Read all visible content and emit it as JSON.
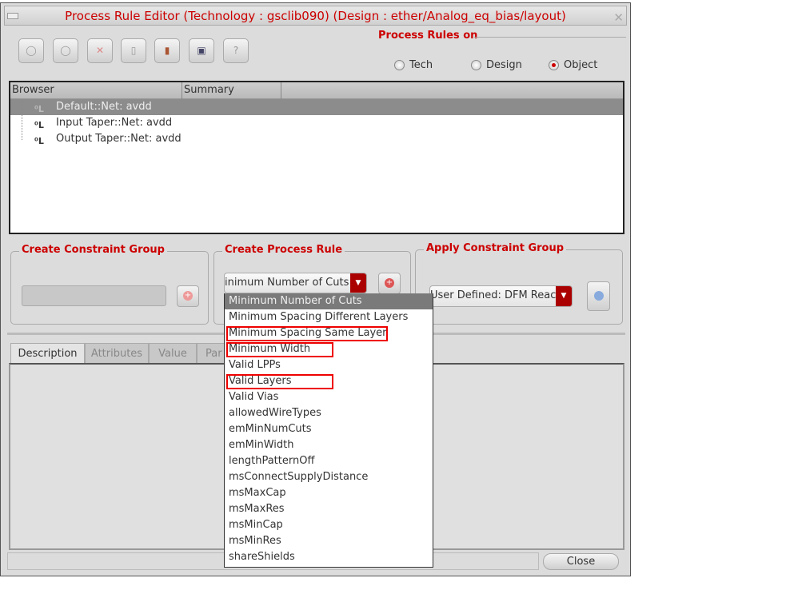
{
  "window": {
    "title": "Process Rule Editor (Technology : gsclib090) (Design : ether/Analog_eq_bias/layout)"
  },
  "toolbar": [
    "circle-icon",
    "circle-icon",
    "delete-icon",
    "copy-icon",
    "paste-icon",
    "save-icon",
    "?"
  ],
  "rules_on": {
    "label": "Process Rules on",
    "options": [
      "Tech",
      "Design",
      "Object"
    ],
    "selected": "Object"
  },
  "browser": {
    "columns": [
      "Browser",
      "Summary"
    ],
    "rows": [
      "Default::Net: avdd",
      "Input Taper::Net: avdd",
      "Output Taper::Net: avdd"
    ],
    "selected": 0
  },
  "groups": {
    "create_cg": "Create Constraint Group",
    "create_pr": "Create Process Rule",
    "apply_cg": "Apply Constraint Group"
  },
  "process_rule_value": "inimum Number of Cuts",
  "apply_value": "User Defined: DFM Reac",
  "tabs": [
    "Description",
    "Attributes",
    "Value",
    "Par"
  ],
  "dropdown": {
    "items": [
      "Minimum Number of Cuts",
      "Minimum Spacing Different Layers",
      "Minimum Spacing Same Layer",
      "Minimum Width",
      "Valid LPPs",
      "Valid Layers",
      "Valid Vias",
      "allowedWireTypes",
      "emMinNumCuts",
      "emMinWidth",
      "lengthPatternOff",
      "msConnectSupplyDistance",
      "msMaxCap",
      "msMaxRes",
      "msMinCap",
      "msMinRes",
      "shareShields"
    ],
    "highlighted": [
      "Minimum Spacing Same Layer",
      "Minimum Width",
      "Valid Layers"
    ]
  },
  "close_label": "Close"
}
